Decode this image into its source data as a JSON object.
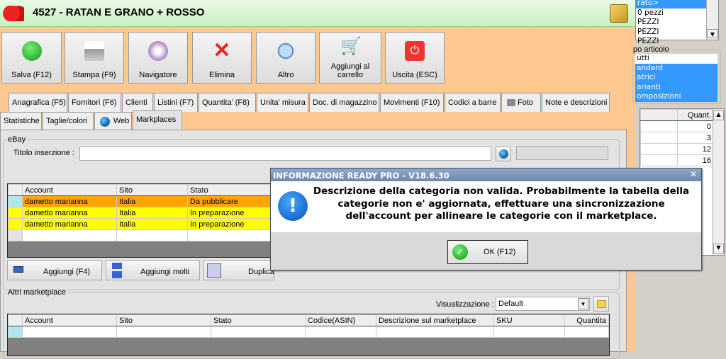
{
  "window": {
    "title": "4527 - RATAN E GRANO + ROSSO"
  },
  "toolbar": [
    {
      "label": "Salva (F12)",
      "icon": "check-icon"
    },
    {
      "label": "Stampa (F9)",
      "icon": "printer-icon"
    },
    {
      "label": "Navigatore",
      "icon": "compass-icon"
    },
    {
      "label": "Elimina",
      "icon": "delete-x-icon"
    },
    {
      "label": "Altro",
      "icon": "magnifier-icon"
    },
    {
      "label": "Aggiungi al carrello",
      "icon": "cart-icon"
    },
    {
      "label": "Uscita (ESC)",
      "icon": "power-icon"
    }
  ],
  "tabs_row1": [
    "Anagrafica (F5)",
    "Fornitori (F6)",
    "Clienti",
    "Listini (F7)",
    "Quantita' (F8)",
    "Unita' misura",
    "Doc. di magazzino",
    "Movimenti (F10)",
    "Codici a barre",
    "Foto",
    "Note e descrizioni"
  ],
  "tabs_row2": [
    "Statistiche",
    "Taglie/colori",
    "Web",
    "Markplaces"
  ],
  "ebay": {
    "legend": "eBay",
    "title_label": "Titolo inserzione :",
    "title_value": "",
    "columns": [
      "Account",
      "Sito",
      "Stato"
    ],
    "rows": [
      {
        "account": "dametto marianna",
        "sito": "Italia",
        "stato": "Da pubblicare"
      },
      {
        "account": "dametto marianna",
        "sito": "Italia",
        "stato": "In preparazione"
      },
      {
        "account": "dametto marianna",
        "sito": "Italia",
        "stato": "In preparazione"
      }
    ],
    "buttons": [
      "Aggiungi (F4)",
      "Aggiungi molti",
      "Duplica"
    ]
  },
  "altri": {
    "legend": "Altri marketplace",
    "view_label": "Visualizzazione :",
    "view_value": "Default",
    "columns": [
      "Account",
      "Sito",
      "Stato",
      "Codice(ASIN)",
      "Descrizione sul marketplace",
      "SKU",
      "Quantita"
    ]
  },
  "right": {
    "top_list": [
      "rato>",
      "0 pezzi",
      "PEZZI",
      "PEZZI",
      "PEZZI"
    ],
    "tipo_legend": "po articolo",
    "tipo_list": [
      "utti",
      "andard",
      "atrici",
      "arianti",
      "omposizioni"
    ],
    "qty_header": "Quant.",
    "qty_values": [
      "0",
      "3",
      "12",
      "16"
    ]
  },
  "dialog": {
    "title": "INFORMAZIONE READY PRO - V18.6.30",
    "message": "Descrizione della categoria non valida. Probabilmente la tabella della categorie non e' aggiornata, effettuare una sincronizzazione dell'account per allineare le categorie con il marketplace.",
    "ok_label": "OK (F12)"
  },
  "colors": {
    "orange_row": "#ffa500",
    "yellow_row": "#ffff00",
    "bg": "#ffc890",
    "select": "#3399ff"
  }
}
